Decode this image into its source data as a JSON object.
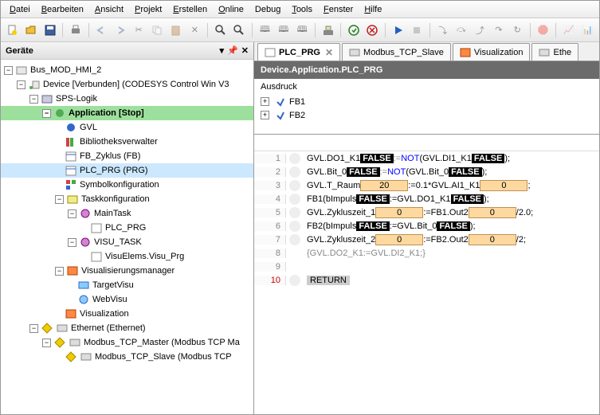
{
  "menu": [
    "Datei",
    "Bearbeiten",
    "Ansicht",
    "Projekt",
    "Erstellen",
    "Online",
    "Debug",
    "Tools",
    "Fenster",
    "Hilfe"
  ],
  "menu_u": [
    "D",
    "B",
    "A",
    "P",
    "E",
    "O",
    "",
    "T",
    "F",
    "H"
  ],
  "panel_title": "Geräte",
  "tree": {
    "root": "Bus_MOD_HMI_2",
    "device": "Device [Verbunden] (CODESYS Control Win V3",
    "sps": "SPS-Logik",
    "app": "Application [Stop]",
    "gvl": "GVL",
    "bib": "Bibliotheksverwalter",
    "fb_zyklus": "FB_Zyklus (FB)",
    "plc_prg": "PLC_PRG (PRG)",
    "symbol": "Symbolkonfiguration",
    "task": "Taskkonfiguration",
    "maintask": "MainTask",
    "plc_prg2": "PLC_PRG",
    "visu_task": "VISU_TASK",
    "visu_elem": "VisuElems.Visu_Prg",
    "vis_mgr": "Visualisierungsmanager",
    "target": "TargetVisu",
    "web": "WebVisu",
    "visualization": "Visualization",
    "eth": "Ethernet (Ethernet)",
    "modbus_m": "Modbus_TCP_Master (Modbus TCP Ma",
    "modbus_s": "Modbus_TCP_Slave (Modbus TCP"
  },
  "tabs": {
    "t1": "PLC_PRG",
    "t2": "Modbus_TCP_Slave",
    "t3": "Visualization",
    "t4": "Ethe"
  },
  "editor_title": "Device.Application.PLC_PRG",
  "vars_header": "Ausdruck",
  "vars": {
    "fb1": "FB1",
    "fb2": "FB2"
  },
  "code": {
    "l1a": "GVL.DO1_K1",
    "l1b": "FALSE",
    "l1c": ":=",
    "l1d": "NOT",
    "l1e": "(GVL.DI1_K1",
    "l1f": "FALSE",
    "l1g": ");",
    "l2a": "GVL.Bit_0",
    "l2f": "FALSE",
    "l2c": ":=",
    "l2d": "NOT",
    "l2e": "(GVL.Bit_0",
    "l2ff": "FALSE",
    "l2g": ");",
    "l3a": "GVL.T_Raum",
    "l3v": "20",
    "l3b": ":=0.1*GVL.AI1_K1",
    "l3v2": "0",
    "l3c": ";",
    "l4a": "FB1(bImpuls",
    "l4f": "FALSE",
    "l4b": ":=GVL.DO1_K1",
    "l4f2": "FALSE",
    "l4c": ");",
    "l5a": "GVL.Zykluszeit_1",
    "l5v": "0",
    "l5b": ":=FB1.Out2",
    "l5v2": "0",
    "l5c": "/2.0;",
    "l6a": "FB2(bImpuls",
    "l6f": "FALSE",
    "l6b": ":=GVL.Bit_0",
    "l6f2": "FALSE",
    "l6c": ");",
    "l7a": "GVL.Zykluszeit_2",
    "l7v": "0",
    "l7b": ":=FB2.Out2",
    "l7v2": "0",
    "l7c": "/2;",
    "l8": "{GVL.DO2_K1:=GVL.DI2_K1;}",
    "l10": "RETURN"
  }
}
